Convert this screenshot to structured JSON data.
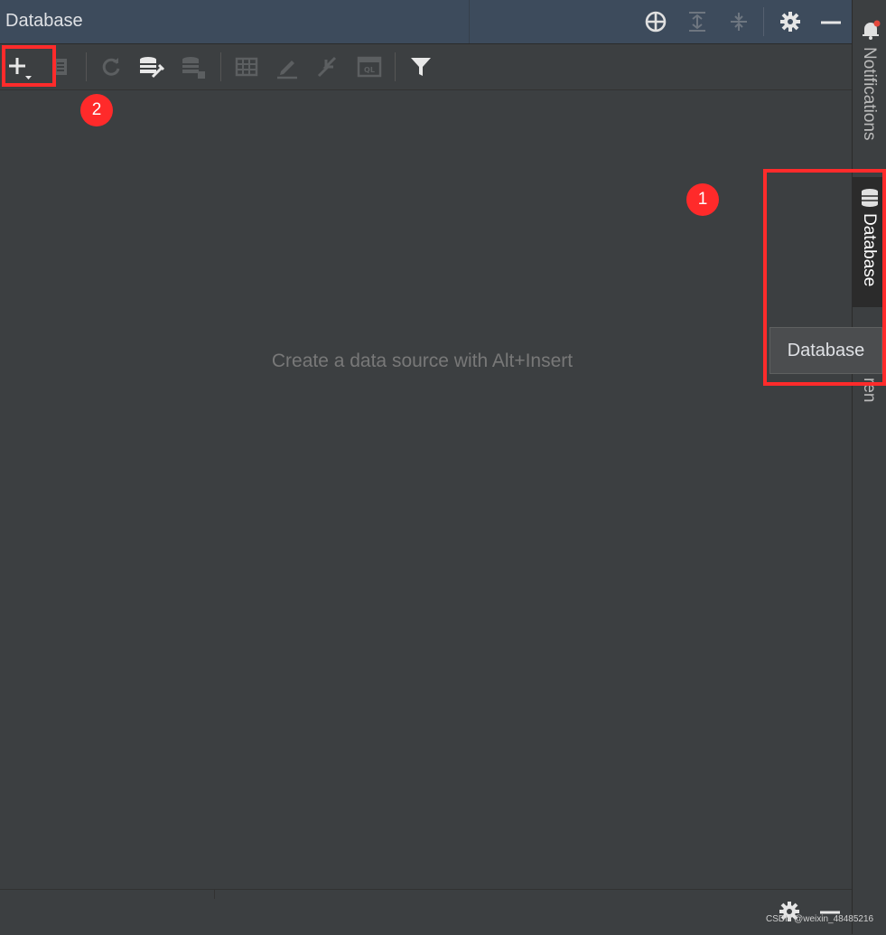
{
  "panel": {
    "title": "Database"
  },
  "header_icons": [
    "crosshair-icon",
    "expand-all-icon",
    "collapse-all-icon",
    "gear-icon",
    "minimize-icon"
  ],
  "toolbar_icons": [
    "add-icon",
    "properties-icon",
    "refresh-icon",
    "db-tools-icon",
    "db-disconnect-icon",
    "table-view-icon",
    "edit-icon",
    "jump-to-source-icon",
    "query-console-icon",
    "filter-icon"
  ],
  "content": {
    "empty_message": "Create a data source with Alt+Insert"
  },
  "right_stripe": {
    "notifications_label": "Notifications",
    "database_label": "Database",
    "hidden_tab_fragment": "ren"
  },
  "tooltip": {
    "text": "Database"
  },
  "annotations": {
    "badge_1": "1",
    "badge_2": "2"
  },
  "watermark": "CSDN @weixin_48485216",
  "colors": {
    "background": "#3c3f41",
    "header": "#3d4b5c",
    "annotation_red": "#ff2b2b",
    "muted_text": "#787878"
  }
}
